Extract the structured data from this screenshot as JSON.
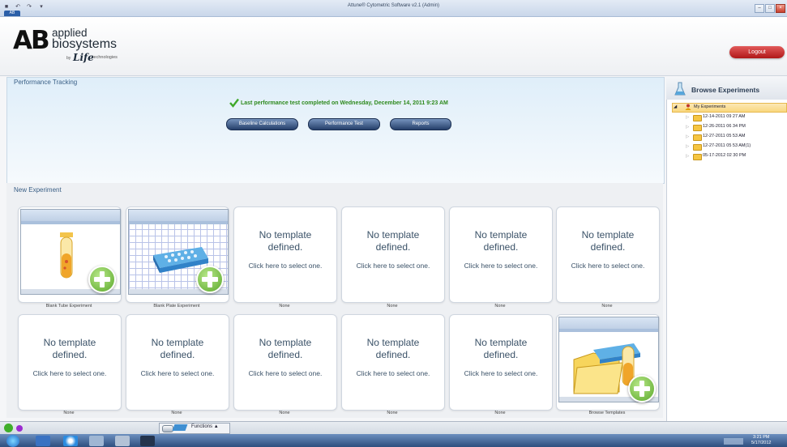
{
  "window": {
    "title": "Attune® Cytometric Software v2.1 (Admin)",
    "app_tab": "AB",
    "min": "–",
    "max": "□",
    "close": "×"
  },
  "header": {
    "logo_ab": "AB",
    "logo_applied": "applied",
    "logo_biosystems": "biosystems",
    "logo_by": "by",
    "logo_life": "Life",
    "logo_tech": "technologies",
    "logout_label": "Logout"
  },
  "performance": {
    "title": "Performance Tracking",
    "status": "Last performance test completed on Wednesday, December 14, 2011 9:23 AM",
    "buttons": [
      "Baseline Calculations",
      "Performance Test",
      "Reports"
    ]
  },
  "new_experiment": {
    "title": "New Experiment",
    "placeholder_title": "No template defined.",
    "placeholder_line1": "No template",
    "placeholder_line2": "defined.",
    "placeholder_action": "Click here to select one.",
    "captions": {
      "blank_tube": "Blank Tube Experiment",
      "blank_plate": "Blank Plate Experiment",
      "none": "None",
      "browse_templates": "Browse Templates"
    }
  },
  "browse": {
    "title": "Browse Experiments",
    "root": "My Experiments",
    "folders": [
      "12-14-2011 09 27 AM",
      "12-26-2011 06 34 PM",
      "12-27-2011 05 53 AM",
      "12-27-2011 05 53 AM(1)",
      "05-17-2012 02 30 PM"
    ]
  },
  "status_bar": {
    "functions_label": "Functions",
    "functions_arrow": "▲"
  },
  "taskbar": {
    "time": "3:21 PM",
    "date": "5/17/2012"
  }
}
